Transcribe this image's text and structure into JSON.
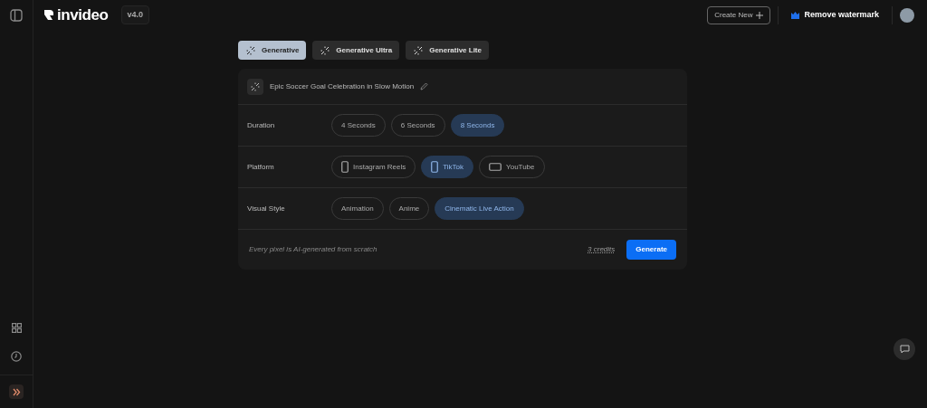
{
  "header": {
    "logo": "invideo",
    "version": "v4.0",
    "create_button": "Create New",
    "watermark_button": "Remove watermark"
  },
  "modes": [
    {
      "label": "Generative",
      "selected": true
    },
    {
      "label": "Generative Ultra",
      "selected": false
    },
    {
      "label": "Generative Lite",
      "selected": false
    }
  ],
  "prompt": "Epic Soccer Goal Celebration in Slow Motion",
  "settings": [
    {
      "label": "Duration",
      "options": [
        {
          "label": "4 Seconds",
          "selected": false,
          "kind": "plain"
        },
        {
          "label": "6 Seconds",
          "selected": false,
          "kind": "plain"
        },
        {
          "label": "8 Seconds",
          "selected": true,
          "kind": "plain"
        }
      ]
    },
    {
      "label": "Platform",
      "options": [
        {
          "label": "Instagram Reels",
          "selected": false,
          "kind": "portrait"
        },
        {
          "label": "TikTok",
          "selected": true,
          "kind": "portrait"
        },
        {
          "label": "YouTube",
          "selected": false,
          "kind": "landscape"
        }
      ]
    },
    {
      "label": "Visual Style",
      "options": [
        {
          "label": "Animation",
          "selected": false,
          "kind": "plain"
        },
        {
          "label": "Anime",
          "selected": false,
          "kind": "plain"
        },
        {
          "label": "Cinematic Live Action",
          "selected": true,
          "kind": "plain"
        }
      ]
    }
  ],
  "footer": {
    "note": "Every pixel is AI-generated from scratch",
    "credits": "3 credits",
    "generate_button": "Generate"
  }
}
